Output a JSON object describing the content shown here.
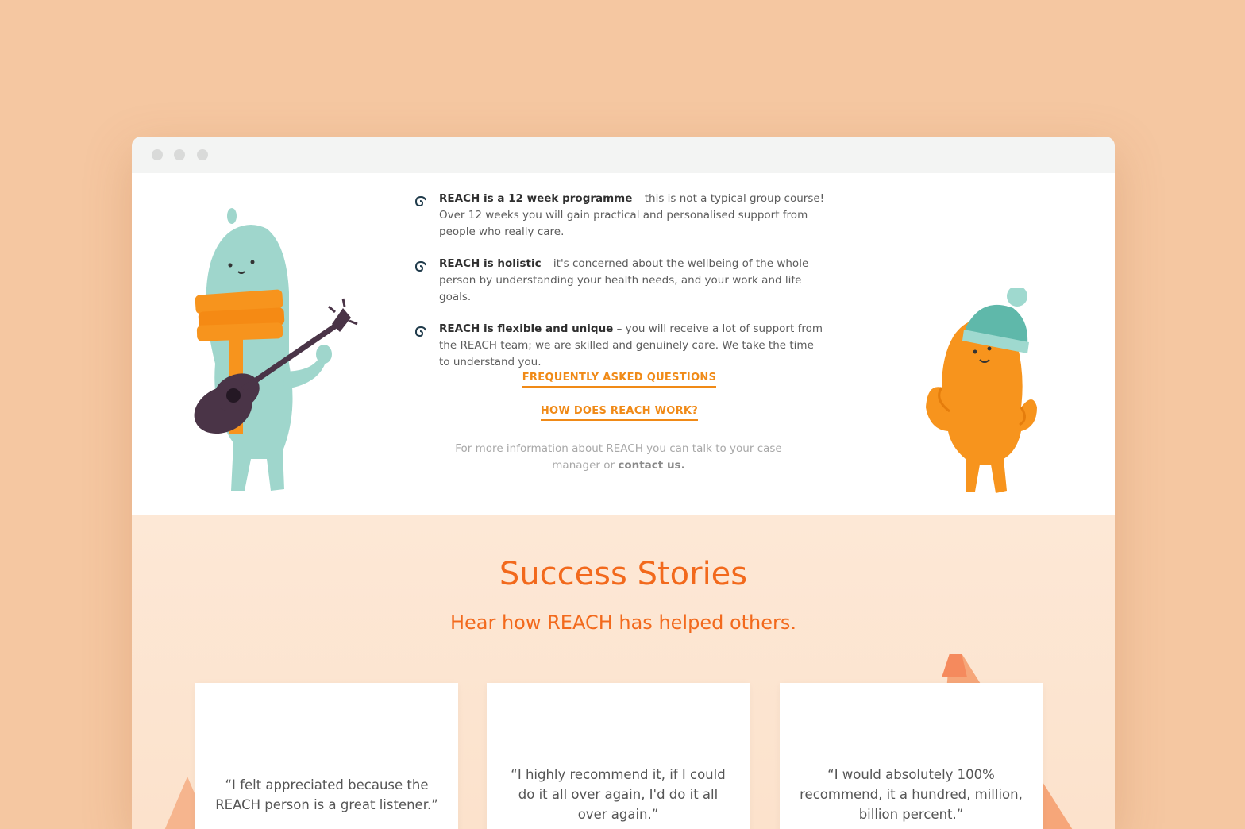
{
  "features": [
    {
      "bold": "REACH is a 12 week programme",
      "text": " – this is not a typical group course! Over 12 weeks you will gain practical and personalised support from people who really care."
    },
    {
      "bold": "REACH is holistic",
      "text": " – it's concerned about the wellbeing of the whole person by understanding your health needs, and your work and life goals."
    },
    {
      "bold": "REACH is flexible and unique",
      "text": " – you will receive a lot of support from the REACH team; we are skilled and genuinely care. We take the time to understand you."
    }
  ],
  "links": {
    "faq": "FREQUENTLY ASKED QUESTIONS",
    "how": "HOW DOES REACH WORK?"
  },
  "more_info": {
    "text": "For more information about REACH you can talk to your case manager or ",
    "link": "contact us."
  },
  "stories": {
    "title": "Success Stories",
    "subtitle": "Hear how REACH has helped others.",
    "quotes": [
      "“I felt appreciated because the REACH person is a great listener.”",
      "“I highly recommend it, if I could do it all over again, I'd do it all over again.”",
      "“I would absolutely 100% recommend, it a hundred, million, billion percent.”"
    ]
  },
  "colors": {
    "background": "#f5c7a1",
    "accent_orange": "#f08a17",
    "title_orange": "#f2691c",
    "stories_bg": "#fde8d6"
  }
}
